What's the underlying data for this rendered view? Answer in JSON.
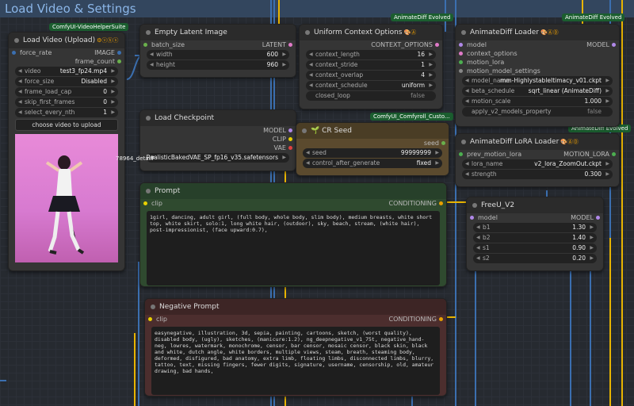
{
  "group": {
    "title": "Load Video & Settings"
  },
  "tags": {
    "vhs": "ComfyUI-VideoHelperSuite",
    "animatediff1": "AnimateDiff Evolved",
    "animatediff2": "AnimateDiff Evolved",
    "animatediff3": "AnimateDiff Evolved",
    "comfyroll": "ComfyUI_Comfyroll_Custo..."
  },
  "load_video": {
    "title": "Load Video (Upload)",
    "inputs": [
      "force_rate"
    ],
    "outputs": [
      "IMAGE",
      "frame_count"
    ],
    "widgets": [
      {
        "label": "video",
        "value": "test3_fp24.mp4"
      },
      {
        "label": "force_size",
        "value": "Disabled"
      },
      {
        "label": "frame_load_cap",
        "value": "0"
      },
      {
        "label": "skip_first_frames",
        "value": "0"
      },
      {
        "label": "select_every_nth",
        "value": "1"
      }
    ],
    "upload_label": "choose video to upload"
  },
  "empty_latent": {
    "title": "Empty Latent Image",
    "input": "batch_size",
    "output": "LATENT",
    "widgets": [
      {
        "label": "width",
        "value": "600"
      },
      {
        "label": "height",
        "value": "960"
      }
    ]
  },
  "context_options": {
    "title": "Uniform Context Options",
    "output": "CONTEXT_OPTIONS",
    "widgets": [
      {
        "label": "context_length",
        "value": "16"
      },
      {
        "label": "context_stride",
        "value": "1"
      },
      {
        "label": "context_overlap",
        "value": "4"
      },
      {
        "label": "context_schedule",
        "value": "uniform"
      },
      {
        "label": "closed_loop",
        "value": "false"
      }
    ]
  },
  "animatediff_loader": {
    "title": "AnimateDiff Loader",
    "inputs": [
      "model",
      "context_options",
      "motion_lora",
      "motion_model_settings"
    ],
    "output": "MODEL",
    "widgets": [
      {
        "label": "model_name",
        "value": "mm-HighlystableItimacy_v01.ckpt"
      },
      {
        "label": "beta_schedule",
        "value": "sqrt_linear (AnimateDiff)"
      },
      {
        "label": "motion_scale",
        "value": "1.000"
      },
      {
        "label": "apply_v2_models_property",
        "value": "false"
      }
    ]
  },
  "load_checkpoint": {
    "title": "Load Checkpoint",
    "outputs": [
      "MODEL",
      "CLIP",
      "VAE"
    ],
    "ckpt_value": "RealisticBakedVAE_SP_fp16_v35.safetensors",
    "overlap_text": "78964_detailF"
  },
  "cr_seed": {
    "title": "CR Seed",
    "output": "seed",
    "widgets": [
      {
        "label": "seed",
        "value": "99999999"
      },
      {
        "label": "control_after_generate",
        "value": "fixed"
      }
    ]
  },
  "lora_loader": {
    "title": "AnimateDiff LoRA Loader",
    "input": "prev_motion_lora",
    "output": "MOTION_LORA",
    "widgets": [
      {
        "label": "lora_name",
        "value": "v2_lora_ZoomOut.ckpt"
      },
      {
        "label": "strength",
        "value": "0.300"
      }
    ]
  },
  "prompt": {
    "title": "Prompt",
    "input": "clip",
    "output": "CONDITIONING",
    "text": "1girl, dancing, adult girl, (full body, whole body, slim body), medium breasts, white short top, white skirt, solo:1, long white hair, (outdoor), sky, beach, stream, (white hair), post-impressionist, (face upward:0.7),"
  },
  "freeu": {
    "title": "FreeU_V2",
    "input": "model",
    "output": "MODEL",
    "widgets": [
      {
        "label": "b1",
        "value": "1.30"
      },
      {
        "label": "b2",
        "value": "1.40"
      },
      {
        "label": "s1",
        "value": "0.90"
      },
      {
        "label": "s2",
        "value": "0.20"
      }
    ]
  },
  "negative": {
    "title": "Negative Prompt",
    "input": "clip",
    "output": "CONDITIONING",
    "text": "easynegative, illustration, 3d, sepia, painting, cartoons, sketch, (worst quality), disabled body, (ugly), sketches, (manicure:1.2), ng_deepnegative_v1_75t, negative_hand-neg, lowres, watermark, monochrome, censor, bar censor, mosaic censor, black skin, black and white, dutch angle, white borders, multiple views, steam, breath, steaming body, deformed, disfigured, bad anatomy, extra limb, floating limbs, disconnected limbs, blurry, tattoo, text, missing fingers, fewer digits, signature, username, censorship, old, amateur drawing, bad hands,"
  },
  "colors": {
    "wire_blue": "#3b6fb0",
    "wire_yellow": "#e8b400",
    "wire_red": "#c0392b",
    "prompt_bg": "#2d4a2d",
    "negative_bg": "#4a2d2d",
    "seed_bg": "#5a4a2d"
  }
}
